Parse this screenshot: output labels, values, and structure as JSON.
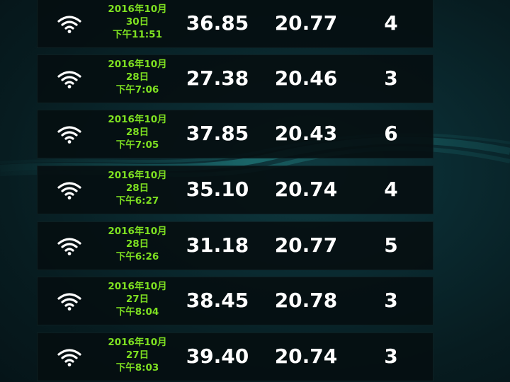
{
  "readings": [
    {
      "date_line1": "2016年10月",
      "date_line2": "30日",
      "date_line3": "下午11:51",
      "value1": "36.85",
      "value2": "20.77",
      "count": "4"
    },
    {
      "date_line1": "2016年10月",
      "date_line2": "28日",
      "date_line3": "下午7:06",
      "value1": "27.38",
      "value2": "20.46",
      "count": "3"
    },
    {
      "date_line1": "2016年10月",
      "date_line2": "28日",
      "date_line3": "下午7:05",
      "value1": "37.85",
      "value2": "20.43",
      "count": "6"
    },
    {
      "date_line1": "2016年10月",
      "date_line2": "28日",
      "date_line3": "下午6:27",
      "value1": "35.10",
      "value2": "20.74",
      "count": "4"
    },
    {
      "date_line1": "2016年10月",
      "date_line2": "28日",
      "date_line3": "下午6:26",
      "value1": "31.18",
      "value2": "20.77",
      "count": "5"
    },
    {
      "date_line1": "2016年10月",
      "date_line2": "27日",
      "date_line3": "下午8:04",
      "value1": "38.45",
      "value2": "20.78",
      "count": "3"
    },
    {
      "date_line1": "2016年10月",
      "date_line2": "27日",
      "date_line3": "下午8:03",
      "value1": "39.40",
      "value2": "20.74",
      "count": "3"
    }
  ],
  "icons": {
    "row_icon": "wifi-icon"
  },
  "colors": {
    "date_text": "#7ee021",
    "value_text": "#ffffff",
    "row_background": "#050e11",
    "page_background": "#0a2a30"
  }
}
